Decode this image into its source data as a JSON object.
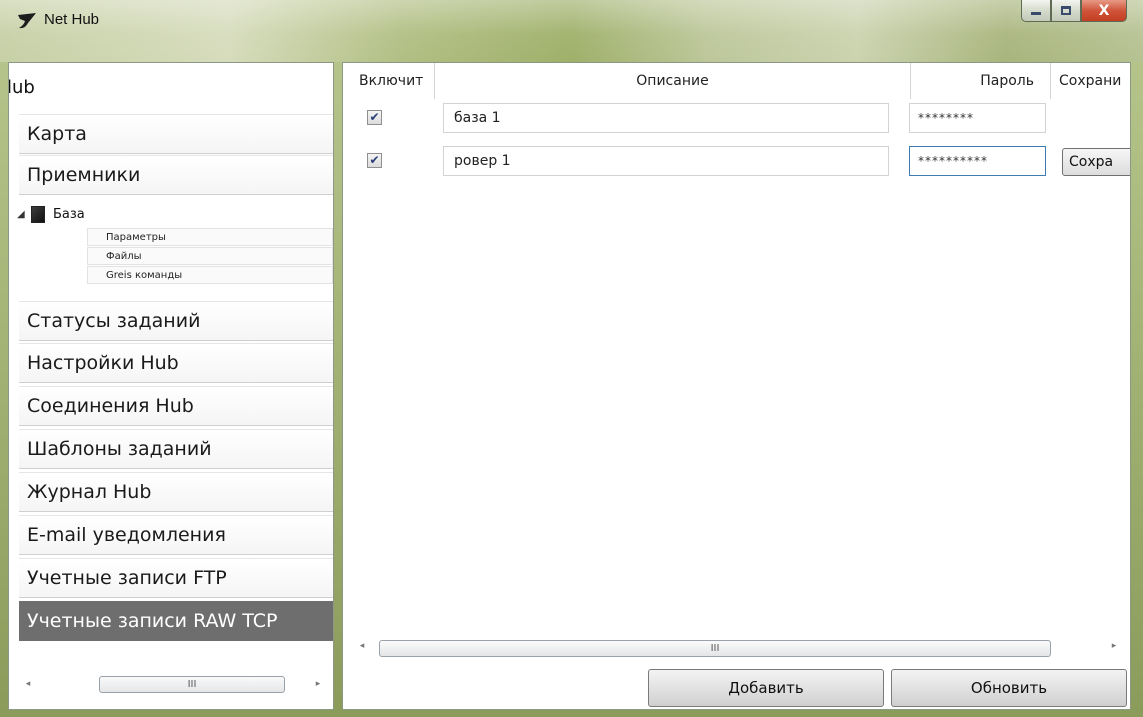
{
  "window": {
    "title": "Net Hub",
    "controls": {
      "minimize": "",
      "maximize": "",
      "close": "X"
    }
  },
  "nav": {
    "header": "lub",
    "items_top": [
      {
        "label": "Карта"
      },
      {
        "label": "Приемники"
      }
    ],
    "tree": {
      "label": "База",
      "children": [
        "Параметры",
        "Файлы",
        "Greis команды"
      ]
    },
    "items_bottom": [
      {
        "label": "Статусы заданий"
      },
      {
        "label": "Настройки Hub"
      },
      {
        "label": "Соединения Hub"
      },
      {
        "label": "Шаблоны заданий"
      },
      {
        "label": "Журнал Hub"
      },
      {
        "label": "E-mail уведомления"
      },
      {
        "label": "Учетные записи FTP"
      },
      {
        "label": "Учетные записи RAW TCP",
        "selected": true
      }
    ],
    "scroll_grip": "III"
  },
  "grid": {
    "columns": {
      "enable": "Включит",
      "description": "Описание",
      "password": "Пароль",
      "save": "Сохрани"
    },
    "rows": [
      {
        "enabled": true,
        "checkmark": "✔",
        "description": "база 1",
        "password": "********",
        "save_button": ""
      },
      {
        "enabled": true,
        "checkmark": "✔",
        "description": "ровер 1",
        "password": "**********",
        "save_button": "Сохра"
      }
    ],
    "scroll_grip": "III"
  },
  "actions": {
    "add": "Добавить",
    "refresh": "Обновить"
  },
  "colors": {
    "selected_item_bg": "#6e6e6e",
    "close_button": "#c33e22",
    "focus_border": "#3d7bb0"
  }
}
